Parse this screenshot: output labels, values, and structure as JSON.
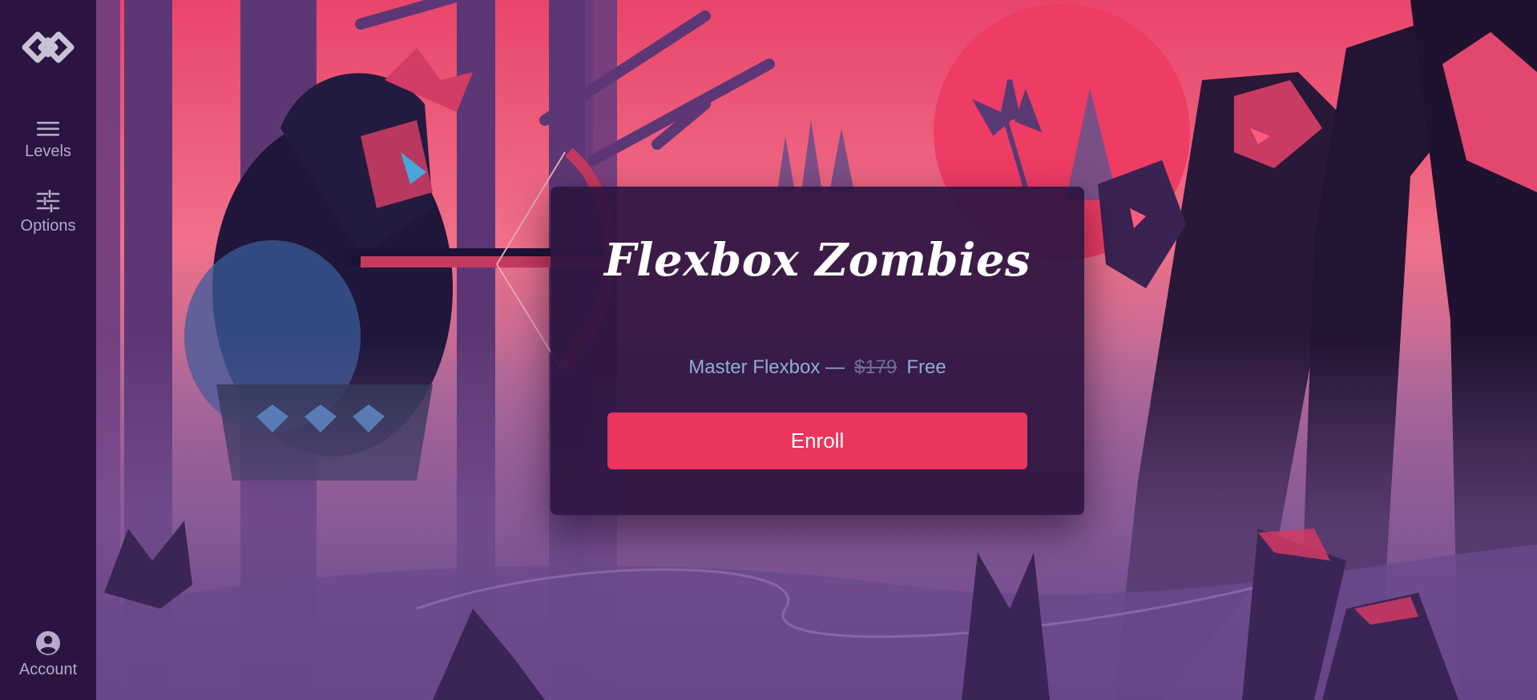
{
  "sidebar": {
    "logo_icon": "diamond-logo-icon",
    "items": [
      {
        "label": "Levels",
        "icon": "menu-icon"
      },
      {
        "label": "Options",
        "icon": "sliders-icon"
      }
    ],
    "account": {
      "label": "Account",
      "icon": "user-circle-icon"
    }
  },
  "card": {
    "title": "Flexbox Zombies",
    "subtitle": "Master Flexbox —",
    "old_price": "$179",
    "new_price": "Free",
    "cta": "Enroll"
  },
  "colors": {
    "sidebar_bg": "#2b1441",
    "card_bg": "#2e1642",
    "accent": "#ea355d",
    "subtitle": "#8eaed8"
  }
}
